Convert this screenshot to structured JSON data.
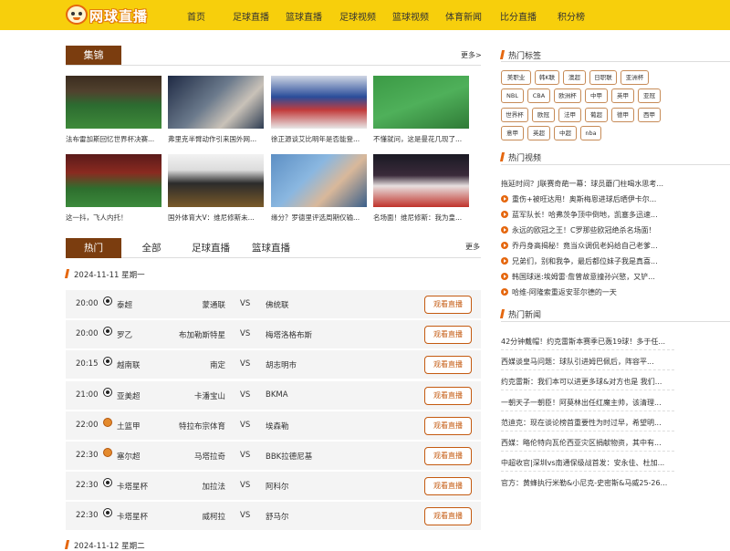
{
  "header": {
    "logo_text": "网球直播",
    "nav": [
      "首页",
      "足球直播",
      "篮球直播",
      "足球视频",
      "篮球视频",
      "体育新闻",
      "比分直播",
      "积分榜"
    ]
  },
  "highlights": {
    "title": "集锦",
    "more": "更多>",
    "items": [
      {
        "caption": "法布雷加斯回忆世界杯决赛..."
      },
      {
        "caption": "弗里克半臂动作引来国外网..."
      },
      {
        "caption": "徐正源谈艾比明年是否能登..."
      },
      {
        "caption": "不懂就问，这是曼花几现了..."
      },
      {
        "caption": "这一抖，飞人内托！"
      },
      {
        "caption": "国外体育大V：维尼修斯未..."
      },
      {
        "caption": "缘分？罗德里评选周期仅输..."
      },
      {
        "caption": "名场面！维尼修斯：我为皇..."
      }
    ]
  },
  "schedule": {
    "tabs": [
      "热门",
      "全部",
      "足球直播",
      "篮球直播"
    ],
    "more": "更多",
    "date1": "2024-11-11 星期一",
    "date2": "2024-11-12 星期二",
    "vs": "VS",
    "watch_label": "观看直播",
    "matches": [
      {
        "time": "20:00",
        "league": "泰超",
        "home": "蒙通联",
        "away": "佛统联",
        "sport": "football"
      },
      {
        "time": "20:00",
        "league": "罗乙",
        "home": "布加勒斯特星",
        "away": "梅塔洛格布斯",
        "sport": "football"
      },
      {
        "time": "20:15",
        "league": "越南联",
        "home": "南定",
        "away": "胡志明市",
        "sport": "football"
      },
      {
        "time": "21:00",
        "league": "亚美超",
        "home": "卡潘宝山",
        "away": "BKMA",
        "sport": "football"
      },
      {
        "time": "22:00",
        "league": "土篮甲",
        "home": "特拉布宗体育",
        "away": "埃森勒",
        "sport": "basketball"
      },
      {
        "time": "22:30",
        "league": "塞尔超",
        "home": "马塔拉奇",
        "away": "BBK拉德尼基",
        "sport": "basketball"
      },
      {
        "time": "22:30",
        "league": "卡塔星杯",
        "home": "加拉法",
        "away": "阿科尔",
        "sport": "football"
      },
      {
        "time": "22:30",
        "league": "卡塔星杯",
        "home": "威柯拉",
        "away": "舒马尔",
        "sport": "football"
      }
    ]
  },
  "sidebar": {
    "tags_title": "热门标签",
    "tags": [
      "美职业",
      "韩K联",
      "澳超",
      "日职联",
      "亚洲杯",
      "NBL",
      "CBA",
      "欧洲杯",
      "中甲",
      "英甲",
      "亚冠",
      "世界杯",
      "欧冠",
      "法甲",
      "葡超",
      "德甲",
      "西甲",
      "意甲",
      "英超",
      "中超",
      "nba"
    ],
    "videos_title": "热门视频",
    "videos": [
      "拖延时间？J联赛奇葩一幕：球员蘑门柱喝水思考...",
      "重伤+被旺达甩！奥斯梅恩进球后晒伊卡尔...",
      "蓝军队长！哈弗茨争顶中倒地，凯塞多迅速...",
      "永远的欧冠之王！C罗那些欧冠绝杀名场面！",
      "乔丹身高揭秘！竟当众调侃老妈给自己老爹...",
      "兄弟们，别和我争，最后都位妹子我是真喜...",
      "韩国球迷:埃姆雷·詹曾故意撞孙兴慜，又铲...",
      "哈维-阿隆索重返安菲尔德的一天"
    ],
    "news_title": "热门新闻",
    "news": [
      "42分钟戴帽！约克雷斯本赛季已轰19球！多于任...",
      "西媒谈皇马问题：球队引进姆巴佩后，阵容平...",
      "约克雷斯：我们本可以进更多球&对方也是 我们...",
      "一朝天子一朝臣！阿莫林出任红魔主帅，该清理...",
      "范迪克：现在谈论榜首重要性为时过早，希望明...",
      "西媒：略伦特向瓦伦西亚灾区捐献物资，其中有...",
      "中超收官|深圳vs南通保级战首发：安永佳、杜加...",
      "官方：黄蜂执行米勒&小尼克-史密斯&马威25-26..."
    ]
  }
}
